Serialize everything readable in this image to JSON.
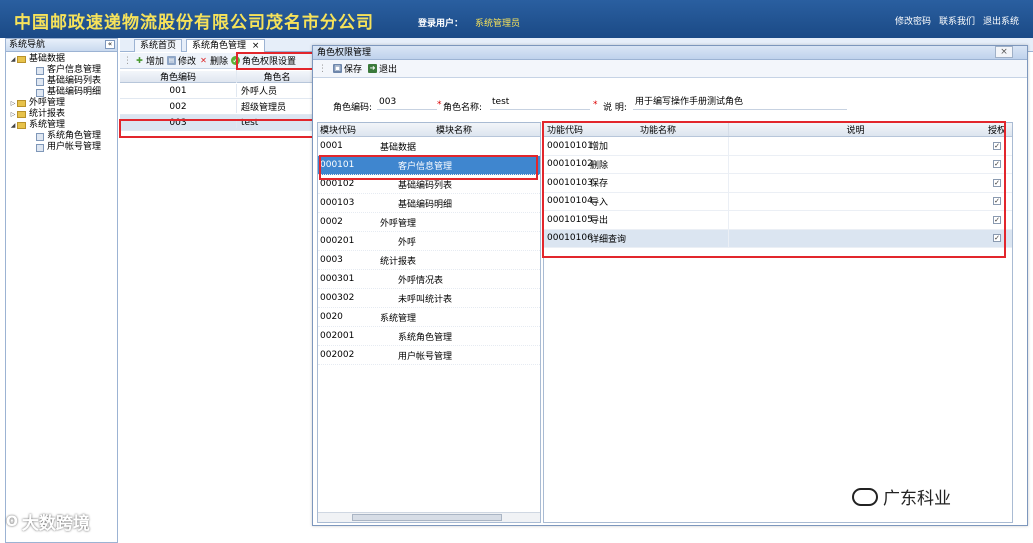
{
  "header": {
    "title": "中国邮政速递物流股份有限公司茂名市分公司",
    "login_label": "登录用户：",
    "login_user": "系统管理员",
    "links": [
      "修改密码",
      "联系我们",
      "退出系统"
    ]
  },
  "sidebar": {
    "title": "系统导航",
    "collapse_icon": "«",
    "items": [
      {
        "label": "基础数据",
        "level": 0,
        "expanded": true
      },
      {
        "label": "客户信息管理",
        "level": 1
      },
      {
        "label": "基础编码列表",
        "level": 1
      },
      {
        "label": "基础编码明细",
        "level": 1
      },
      {
        "label": "外呼管理",
        "level": 0,
        "expanded": false
      },
      {
        "label": "统计报表",
        "level": 0,
        "expanded": false
      },
      {
        "label": "系统管理",
        "level": 0,
        "expanded": true
      },
      {
        "label": "系统角色管理",
        "level": 1
      },
      {
        "label": "用户帐号管理",
        "level": 1
      }
    ]
  },
  "tabs": [
    {
      "label": "系统首页"
    },
    {
      "label": "系统角色管理",
      "close": "×"
    }
  ],
  "toolbar": {
    "add": "增加",
    "edit": "修改",
    "delete": "删除",
    "perm": "角色权限设置"
  },
  "role_grid": {
    "columns": [
      "角色编码",
      "角色名"
    ],
    "rows": [
      [
        "001",
        "外呼人员"
      ],
      [
        "002",
        "超级管理员"
      ],
      [
        "003",
        "test"
      ]
    ]
  },
  "dialog": {
    "title": "角色权限管理",
    "close": "×",
    "save": "保存",
    "exit": "退出",
    "form": {
      "code_label": "角色编码:",
      "code_value": "003",
      "name_label": "角色名称:",
      "name_value": "test",
      "desc_label": "说 明:",
      "desc_value": "用于编写操作手册测试角色"
    },
    "modules": {
      "columns": [
        "模块代码",
        "模块名称"
      ],
      "rows": [
        {
          "code": "0001",
          "name": "基础数据",
          "level": 0
        },
        {
          "code": "000101",
          "name": "客户信息管理",
          "level": 1
        },
        {
          "code": "000102",
          "name": "基础编码列表",
          "level": 1
        },
        {
          "code": "000103",
          "name": "基础编码明细",
          "level": 1
        },
        {
          "code": "0002",
          "name": "外呼管理",
          "level": 0
        },
        {
          "code": "000201",
          "name": "外呼",
          "level": 1
        },
        {
          "code": "0003",
          "name": "统计报表",
          "level": 0
        },
        {
          "code": "000301",
          "name": "外呼情况表",
          "level": 1
        },
        {
          "code": "000302",
          "name": "未呼叫统计表",
          "level": 1
        },
        {
          "code": "0020",
          "name": "系统管理",
          "level": 0
        },
        {
          "code": "002001",
          "name": "系统角色管理",
          "level": 1
        },
        {
          "code": "002002",
          "name": "用户帐号管理",
          "level": 1
        }
      ]
    },
    "functions": {
      "columns": [
        "功能代码",
        "功能名称",
        "说明",
        "授权"
      ],
      "rows": [
        {
          "code": "00010101",
          "name": "增加",
          "desc": "",
          "checked": true
        },
        {
          "code": "00010102",
          "name": "删除",
          "desc": "",
          "checked": true
        },
        {
          "code": "00010103",
          "name": "保存",
          "desc": "",
          "checked": true
        },
        {
          "code": "00010104",
          "name": "导入",
          "desc": "",
          "checked": true
        },
        {
          "code": "00010105",
          "name": "导出",
          "desc": "",
          "checked": true
        },
        {
          "code": "00010106",
          "name": "详细查询",
          "desc": "",
          "checked": true
        }
      ]
    }
  },
  "watermarks": {
    "left": "大数跨境",
    "right": "广东科业"
  },
  "colors": {
    "header": "#1f4f8e",
    "title_text": "#f6e25a",
    "highlight": "#e2262c",
    "selected_row": "#3f86cf"
  }
}
